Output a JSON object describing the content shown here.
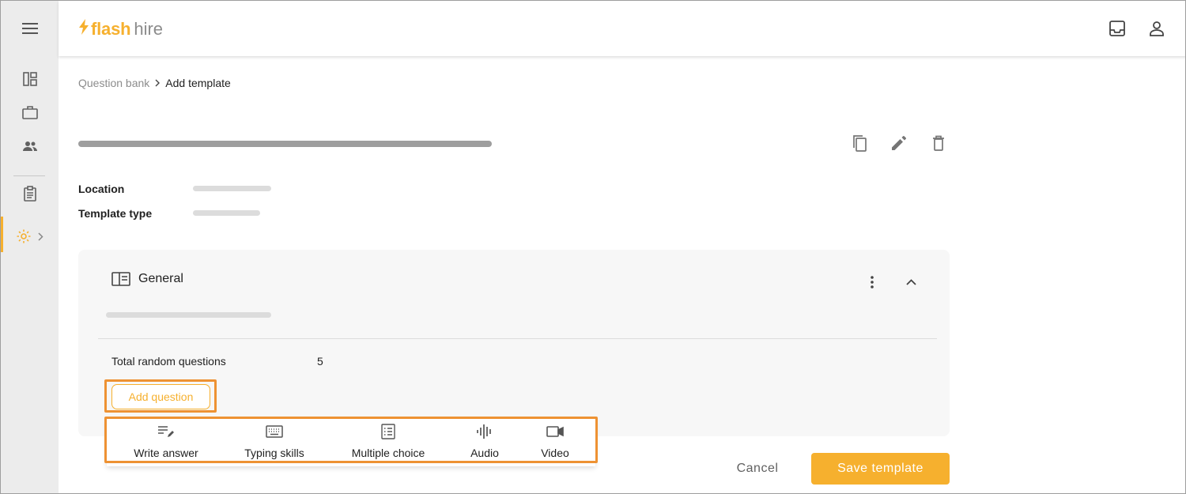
{
  "app": {
    "logo_flash": "flash",
    "logo_hire": "hire",
    "brand_color": "#f6b02e"
  },
  "sidebar": {
    "items": [
      {
        "icon": "menu-icon"
      },
      {
        "icon": "dashboard-icon"
      },
      {
        "icon": "briefcase-icon"
      },
      {
        "icon": "people-icon"
      },
      {
        "icon": "clipboard-icon"
      },
      {
        "icon": "settings-icon",
        "active": true
      }
    ]
  },
  "header": {
    "icons": [
      "inbox-icon",
      "account-icon"
    ]
  },
  "breadcrumb": {
    "parent": "Question bank",
    "current": "Add template"
  },
  "template": {
    "actions": [
      "copy-icon",
      "edit-icon",
      "delete-icon"
    ],
    "location_label": "Location",
    "type_label": "Template type"
  },
  "section": {
    "title": "General",
    "total_random_label": "Total random questions",
    "total_random_value": "5",
    "add_question_label": "Add question"
  },
  "question_types": [
    {
      "label": "Write answer",
      "icon": "write-answer-icon"
    },
    {
      "label": "Typing skills",
      "icon": "keyboard-icon"
    },
    {
      "label": "Multiple choice",
      "icon": "list-icon"
    },
    {
      "label": "Audio",
      "icon": "audio-wave-icon"
    },
    {
      "label": "Video",
      "icon": "video-camera-icon"
    }
  ],
  "footer": {
    "cancel_label": "Cancel",
    "save_label": "Save template"
  },
  "colors": {
    "accent": "#f6b02e",
    "highlight_outline": "#ee9233",
    "sidebar_bg": "#ececec",
    "card_bg": "#f7f7f7"
  }
}
